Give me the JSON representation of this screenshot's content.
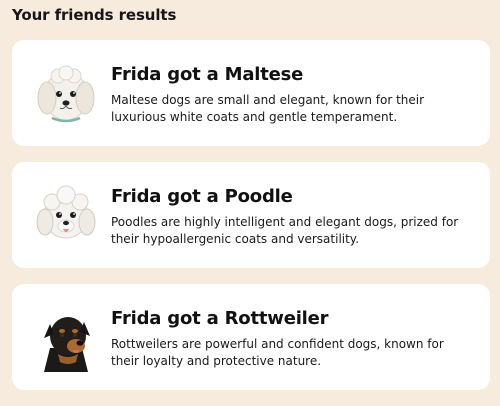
{
  "section": {
    "title": "Your friends results"
  },
  "results": [
    {
      "title": "Frida got a Maltese",
      "description": "Maltese dogs are small and elegant, known for their luxurious white coats and gentle temperament.",
      "icon": "maltese-dog-icon"
    },
    {
      "title": "Frida got a Poodle",
      "description": "Poodles are highly intelligent and elegant dogs, prized for their hypoallergenic coats and versatility.",
      "icon": "poodle-dog-icon"
    },
    {
      "title": "Frida got a Rottweiler",
      "description": "Rottweilers are powerful and confident dogs, known for their loyalty and protective nature.",
      "icon": "rottweiler-dog-icon"
    }
  ],
  "colors": {
    "background": "#f6ebdd",
    "card": "#ffffff",
    "text": "#111111"
  }
}
